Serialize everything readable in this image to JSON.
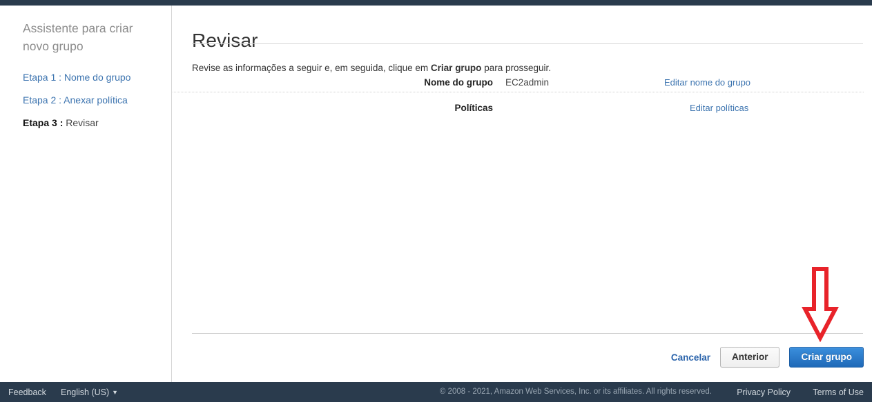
{
  "sidebar": {
    "title": "Assistente para criar novo grupo",
    "steps": [
      {
        "label": "Etapa 1 : Nome do grupo",
        "state": "link"
      },
      {
        "label": "Etapa 2 : Anexar política",
        "state": "link"
      }
    ],
    "current_step": {
      "number": "Etapa 3 :",
      "label": "Revisar"
    }
  },
  "main": {
    "page_title": "Revisar",
    "intro_prefix": "Revise as informações a seguir e, em seguida, clique em ",
    "intro_bold": "Criar grupo",
    "intro_suffix": " para prosseguir.",
    "rows": [
      {
        "label": "Nome do grupo",
        "value": "EC2admin",
        "edit_link": "Editar nome do grupo"
      },
      {
        "label": "Políticas",
        "value": "",
        "edit_link": "Editar políticas"
      }
    ]
  },
  "actions": {
    "cancel": "Cancelar",
    "previous": "Anterior",
    "create": "Criar grupo"
  },
  "annotation": {
    "type": "down-arrow",
    "color": "#e8232a",
    "points_at": "Criar grupo"
  },
  "footer": {
    "feedback": "Feedback",
    "language": "English (US)",
    "caret": "▼",
    "copyright": "© 2008 - 2021, Amazon Web Services, Inc. or its affiliates. All rights reserved.",
    "privacy": "Privacy Policy",
    "terms": "Terms of Use"
  },
  "colors": {
    "chrome_dark": "#2a3b4d",
    "link_blue": "#3b73af",
    "primary_button": "#2370c4",
    "annotation_red": "#e8232a"
  }
}
